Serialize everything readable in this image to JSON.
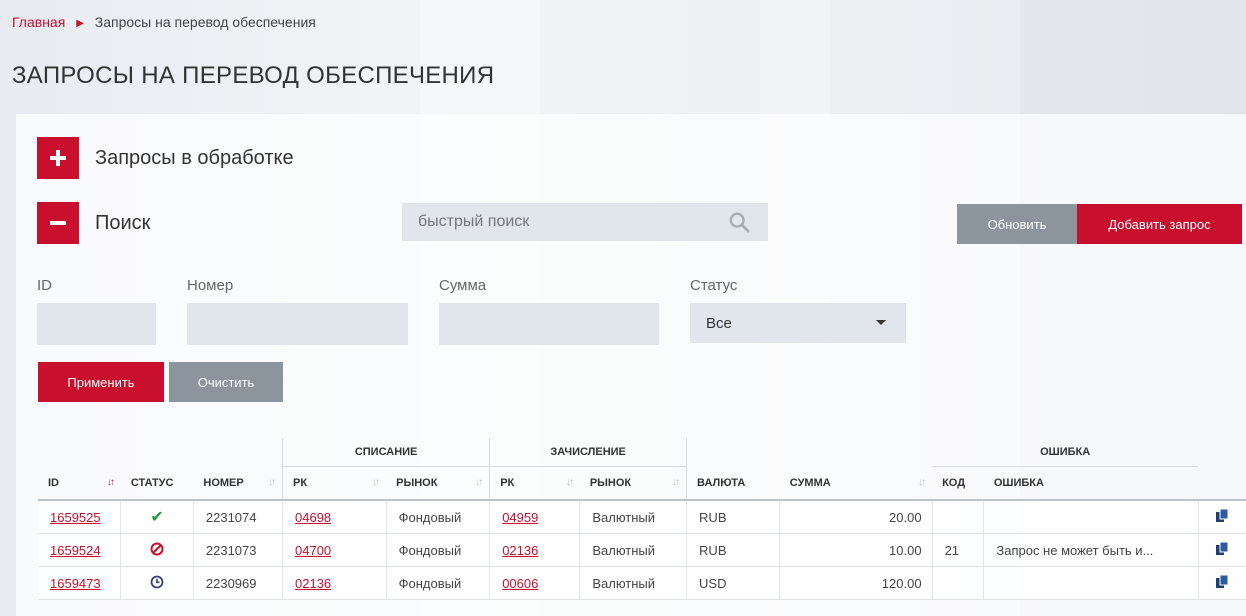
{
  "breadcrumb": {
    "home": "Главная",
    "current": "Запросы на перевод обеспечения"
  },
  "page_title": "ЗАПРОСЫ НА ПЕРЕВОД ОБЕСПЕЧЕНИЯ",
  "sections": {
    "processing": "Запросы в обработке",
    "search": "Поиск"
  },
  "quick_search": {
    "placeholder": "быстрый поиск",
    "icon": "search-icon"
  },
  "buttons": {
    "refresh": "Обновить",
    "add_request": "Добавить запрос",
    "apply": "Применить",
    "clear": "Очистить"
  },
  "filters": {
    "id_label": "ID",
    "number_label": "Номер",
    "sum_label": "Сумма",
    "status_label": "Статус",
    "status_selected": "Все"
  },
  "table": {
    "groups": {
      "debit": "СПИСАНИЕ",
      "credit": "ЗАЧИСЛЕНИЕ",
      "error": "ОШИБКА"
    },
    "columns": {
      "id": "ID",
      "status": "СТАТУС",
      "number": "НОМЕР",
      "debit_rk": "РК",
      "debit_market": "РЫНОК",
      "credit_rk": "РК",
      "credit_market": "РЫНОК",
      "currency": "ВАЛЮТА",
      "sum": "СУММА",
      "error_code": "КОД",
      "error_text": "ОШИБКА"
    },
    "rows": [
      {
        "id": "1659525",
        "status": "success",
        "number": "2231074",
        "debit_rk": "04698",
        "debit_market": "Фондовый",
        "credit_rk": "04959",
        "credit_market": "Валютный",
        "currency": "RUB",
        "sum": "20.00",
        "error_code": "",
        "error_text": ""
      },
      {
        "id": "1659524",
        "status": "rejected",
        "number": "2231073",
        "debit_rk": "04700",
        "debit_market": "Фондовый",
        "credit_rk": "02136",
        "credit_market": "Валютный",
        "currency": "RUB",
        "sum": "10.00",
        "error_code": "21",
        "error_text": "Запрос не может быть и..."
      },
      {
        "id": "1659473",
        "status": "pending",
        "number": "2230969",
        "debit_rk": "02136",
        "debit_market": "Фондовый",
        "credit_rk": "00606",
        "credit_market": "Валютный",
        "currency": "USD",
        "sum": "120.00",
        "error_code": "",
        "error_text": ""
      }
    ]
  },
  "colors": {
    "accent": "#c8102e",
    "gray_button": "#8c959e",
    "input_bg": "#e1e6ec",
    "success": "#1f9b3a",
    "pending": "#3a3f7a"
  }
}
